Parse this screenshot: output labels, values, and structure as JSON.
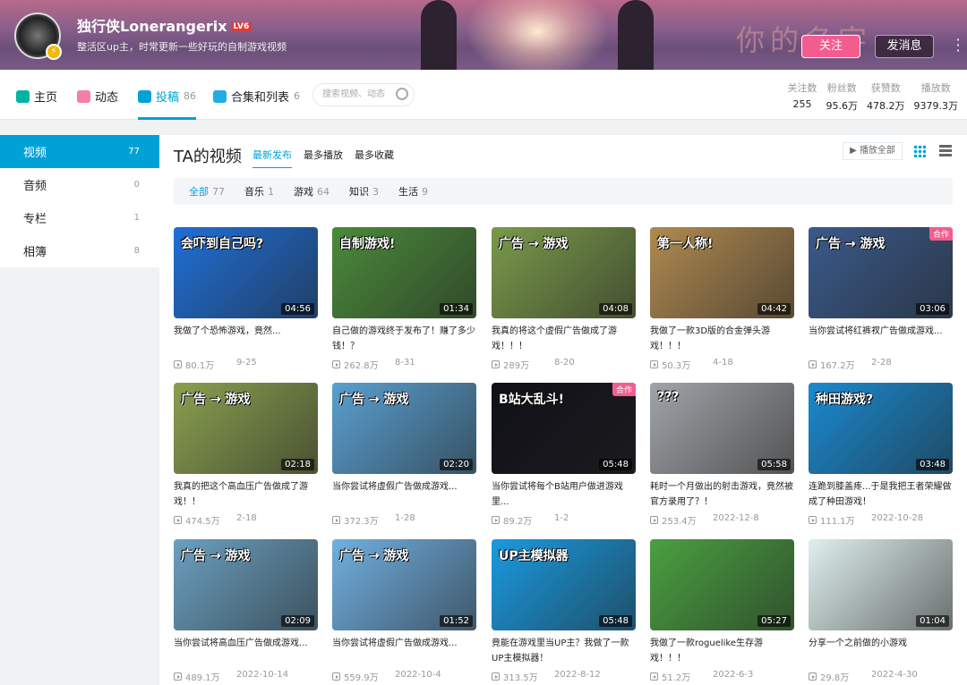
{
  "header": {
    "username": "独行侠Lonerangerix",
    "level": "LV6",
    "sign": "整活区up主，时常更新一些好玩的自制游戏视频",
    "banner_text": "你的名字",
    "follow_label": "关注",
    "message_label": "发消息"
  },
  "nav": {
    "items": [
      {
        "label": "主页",
        "count": "",
        "icon": "home-icon",
        "color": "#00b5a0"
      },
      {
        "label": "动态",
        "count": "",
        "icon": "dynamic-icon",
        "color": "#f47fa4"
      },
      {
        "label": "投稿",
        "count": "86",
        "icon": "upload-icon",
        "color": "#00a1d6"
      },
      {
        "label": "合集和列表",
        "count": "6",
        "icon": "playlist-icon",
        "color": "#23ade5"
      }
    ],
    "search_placeholder": "搜索视频、动态"
  },
  "stats": [
    {
      "label": "关注数",
      "value": "255"
    },
    {
      "label": "粉丝数",
      "value": "95.6万"
    },
    {
      "label": "获赞数",
      "value": "478.2万"
    },
    {
      "label": "播放数",
      "value": "9379.3万"
    }
  ],
  "sidebar": [
    {
      "label": "视频",
      "count": "77"
    },
    {
      "label": "音频",
      "count": "0"
    },
    {
      "label": "专栏",
      "count": "1"
    },
    {
      "label": "相簿",
      "count": "8"
    }
  ],
  "main": {
    "title": "TA的视频",
    "sorts": [
      "最新发布",
      "最多播放",
      "最多收藏"
    ],
    "play_all": "播放全部",
    "filters": [
      {
        "label": "全部",
        "count": "77"
      },
      {
        "label": "音乐",
        "count": "1"
      },
      {
        "label": "游戏",
        "count": "64"
      },
      {
        "label": "知识",
        "count": "3"
      },
      {
        "label": "生活",
        "count": "9"
      }
    ]
  },
  "accent": "#00a1d6",
  "coop_label": "合作",
  "videos": [
    {
      "title": "我做了个恐怖游戏，竟然...",
      "plays": "80.1万",
      "date": "9-25",
      "duration": "04:56",
      "cap": "会吓到自己吗?",
      "bg": "#1f6fd6",
      "coop": false
    },
    {
      "title": "自己做的游戏终于发布了！赚了多少钱！？",
      "plays": "262.8万",
      "date": "8-31",
      "duration": "01:34",
      "cap": "自制游戏!",
      "bg": "#4a8a3a",
      "coop": false
    },
    {
      "title": "我真的将这个虚假广告做成了游戏！！！",
      "plays": "289万",
      "date": "8-20",
      "duration": "04:08",
      "cap": "广告 → 游戏",
      "bg": "#7a9a4a",
      "coop": false
    },
    {
      "title": "我做了一款3D版的合金弹头游戏！！！",
      "plays": "50.3万",
      "date": "4-18",
      "duration": "04:42",
      "cap": "第一人称!",
      "bg": "#b08a50",
      "coop": false
    },
    {
      "title": "当你尝试将红裤衩广告做成游戏...",
      "plays": "167.2万",
      "date": "2-28",
      "duration": "03:06",
      "cap": "广告 → 游戏",
      "bg": "#3a5a8a",
      "coop": true
    },
    {
      "title": "我真的把这个高血压广告做成了游戏！！",
      "plays": "474.5万",
      "date": "2-18",
      "duration": "02:18",
      "cap": "广告 → 游戏",
      "bg": "#8aa050",
      "coop": false
    },
    {
      "title": "当你尝试将虚假广告做成游戏...",
      "plays": "372.3万",
      "date": "1-28",
      "duration": "02:20",
      "cap": "广告 → 游戏",
      "bg": "#5aa0d0",
      "coop": false
    },
    {
      "title": "当你尝试将每个B站用户做进游戏里...",
      "plays": "89.2万",
      "date": "1-2",
      "duration": "05:48",
      "cap": "B站大乱斗!",
      "bg": "#101018",
      "coop": true
    },
    {
      "title": "耗时一个月做出的射击游戏，竟然被官方录用了？！",
      "plays": "253.4万",
      "date": "2022-12-8",
      "duration": "05:58",
      "cap": "???",
      "bg": "#a0a4a8",
      "coop": false
    },
    {
      "title": "连跪到膝盖疼...于是我把王者荣耀做成了种田游戏！",
      "plays": "111.1万",
      "date": "2022-10-28",
      "duration": "03:48",
      "cap": "种田游戏?",
      "bg": "#1a8ad0",
      "coop": false
    },
    {
      "title": "当你尝试将高血压广告做成游戏...",
      "plays": "489.1万",
      "date": "2022-10-14",
      "duration": "02:09",
      "cap": "广告 → 游戏",
      "bg": "#6aa0c0",
      "coop": false
    },
    {
      "title": "当你尝试将虚假广告做成游戏...",
      "plays": "559.9万",
      "date": "2022-10-4",
      "duration": "01:52",
      "cap": "广告 → 游戏",
      "bg": "#70b0e0",
      "coop": false
    },
    {
      "title": "竟能在游戏里当UP主？我做了一款UP主模拟器！",
      "plays": "313.5万",
      "date": "2022-8-12",
      "duration": "05:48",
      "cap": "UP主模拟器",
      "bg": "#1a9ae0",
      "coop": false
    },
    {
      "title": "我做了一款roguelike生存游戏！！！",
      "plays": "51.2万",
      "date": "2022-6-3",
      "duration": "05:27",
      "cap": "",
      "bg": "#4aa040",
      "coop": false
    },
    {
      "title": "分享一个之前做的小游戏",
      "plays": "29.8万",
      "date": "2022-4-30",
      "duration": "01:04",
      "cap": "",
      "bg": "#dff0ee",
      "coop": false
    }
  ]
}
